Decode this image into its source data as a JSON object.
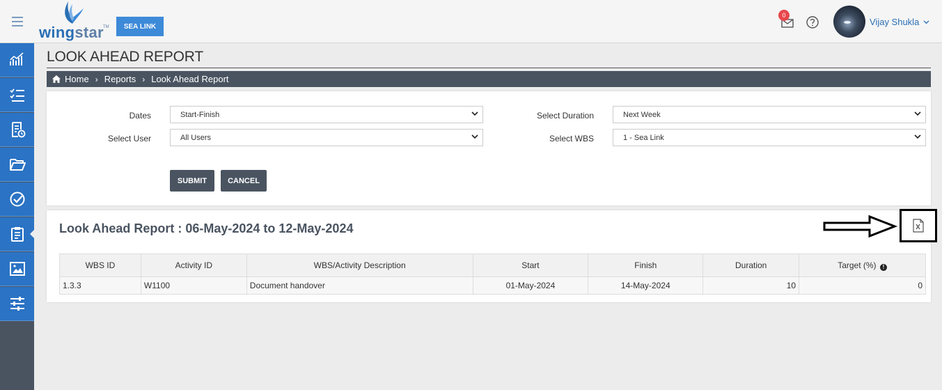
{
  "header": {
    "logo_part1": "wing",
    "logo_part2": "star",
    "logo_tm": "TM",
    "project_button": "SEA LINK",
    "mail_count": "0",
    "user_name": "Vijay Shukla",
    "brand_color": "#2b73c4"
  },
  "sidebar": {
    "items": [
      {
        "icon": "chart-icon"
      },
      {
        "icon": "checklist-icon"
      },
      {
        "icon": "report-clock-icon"
      },
      {
        "icon": "folder-icon"
      },
      {
        "icon": "check-circle-icon"
      },
      {
        "icon": "clipboard-icon"
      },
      {
        "icon": "image-icon"
      },
      {
        "icon": "sliders-icon"
      }
    ]
  },
  "page": {
    "title": "LOOK AHEAD REPORT",
    "breadcrumb": [
      "Home",
      "Reports",
      "Look Ahead Report"
    ]
  },
  "filters": {
    "dates_label": "Dates",
    "dates_value": "Start-Finish",
    "user_label": "Select User",
    "user_value": "All Users",
    "duration_label": "Select Duration",
    "duration_value": "Next Week",
    "wbs_label": "Select WBS",
    "wbs_value": "1 - Sea Link",
    "submit": "SUBMIT",
    "cancel": "CANCEL"
  },
  "report": {
    "title": "Look Ahead Report : 06-May-2024 to 12-May-2024",
    "columns": [
      "WBS ID",
      "Activity ID",
      "WBS/Activity Description",
      "Start",
      "Finish",
      "Duration",
      "Target (%)"
    ],
    "rows": [
      [
        "1.3.3",
        "W1100",
        "Document handover",
        "01-May-2024",
        "14-May-2024",
        "10",
        "0"
      ]
    ]
  }
}
